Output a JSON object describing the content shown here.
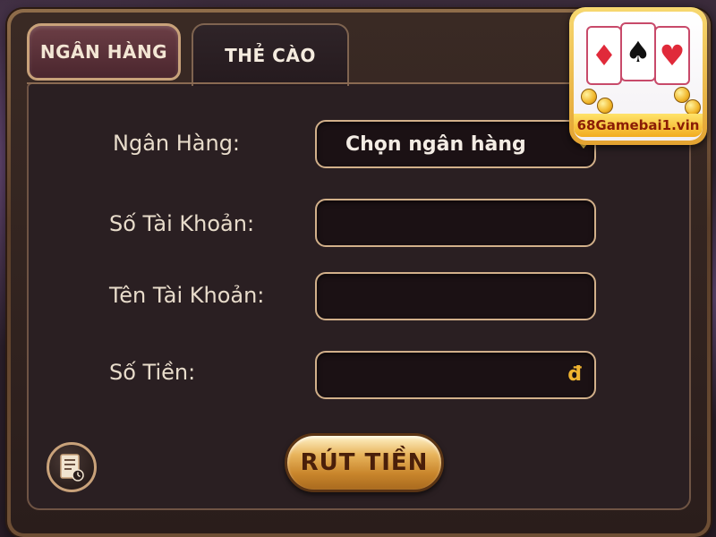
{
  "tabs": {
    "bank": "NGÂN HÀNG",
    "card": "THẺ CÀO"
  },
  "form": {
    "bank_label": "Ngân Hàng:",
    "bank_select_value": "Chọn ngân hàng",
    "account_number_label": "Số Tài Khoản:",
    "account_number_value": "",
    "account_name_label": "Tên Tài Khoản:",
    "account_name_value": "",
    "amount_label": "Số Tiền:",
    "amount_value": "",
    "currency_symbol": "đ"
  },
  "actions": {
    "withdraw": "RÚT TIỀN",
    "history_icon": "history-icon"
  },
  "logo": {
    "text": "68Gamebai1.vin"
  },
  "colors": {
    "accent_gold": "#f0c84a",
    "field_border": "#d2b08a",
    "label_text": "#e8dccb"
  }
}
